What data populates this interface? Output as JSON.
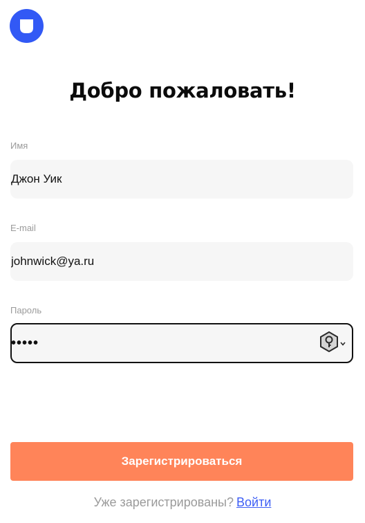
{
  "brand": {
    "logo_icon": "rounded-square-logo-icon",
    "color": "#3259f5"
  },
  "title": "Добро пожаловать!",
  "form": {
    "name": {
      "label": "Имя",
      "value": "Джон Уик"
    },
    "email": {
      "label": "E-mail",
      "value": "johnwick@ya.ru"
    },
    "password": {
      "label": "Пароль",
      "value": "•••••",
      "key_icon": "password-key-icon",
      "dropdown_icon": "chevron-down-icon"
    }
  },
  "submit_label": "Зарегистрироваться",
  "footer": {
    "text": "Уже зарегистрированы?",
    "link": "Войти"
  },
  "colors": {
    "accent": "#ff8459",
    "link": "#3d5ef5",
    "label": "#9a9a9a",
    "field_bg": "#f6f6f6"
  }
}
